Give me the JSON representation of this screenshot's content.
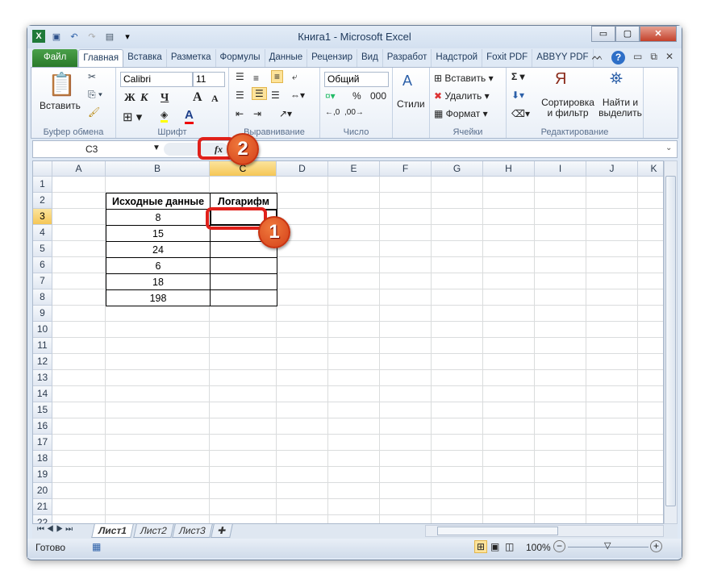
{
  "window": {
    "title": "Книга1  -  Microsoft Excel",
    "minimize": "▭",
    "restore": "▢",
    "close": "✕"
  },
  "tabs": [
    "Файл",
    "Главная",
    "Вставка",
    "Разметка",
    "Формулы",
    "Данные",
    "Рецензир",
    "Вид",
    "Разработ",
    "Надстрой",
    "Foxit PDF",
    "ABBYY PDF"
  ],
  "ribbon": {
    "clipboard": {
      "paste": "Вставить",
      "label": "Буфер обмена"
    },
    "font": {
      "name": "Calibri",
      "size": "11",
      "bold": "Ж",
      "italic": "К",
      "underline": "Ч",
      "grow": "A",
      "shrink": "A",
      "color": "A",
      "label": "Шрифт"
    },
    "alignment": {
      "label": "Выравнивание"
    },
    "number": {
      "format": "Общий",
      "percent": "%",
      "thousands": "000",
      "label": "Число"
    },
    "styles": {
      "label": "Стили"
    },
    "cells": {
      "insert": "Вставить",
      "delete": "Удалить",
      "format": "Формат",
      "label": "Ячейки"
    },
    "editing": {
      "sum": "Σ",
      "sort": "Сортировка и фильтр",
      "find": "Найти и выделить",
      "label": "Редактирование"
    }
  },
  "formula_bar": {
    "name_box": "C3",
    "fx": "fx",
    "value": ""
  },
  "columns": [
    "A",
    "B",
    "C",
    "D",
    "E",
    "F",
    "G",
    "H",
    "I",
    "J",
    "K"
  ],
  "selected": {
    "column": "C",
    "row": 3
  },
  "rows": 22,
  "table": {
    "header_b": "Исходные данные",
    "header_c": "Логарифм",
    "values": [
      "8",
      "15",
      "24",
      "6",
      "18",
      "198"
    ]
  },
  "sheets": [
    "Лист1",
    "Лист2",
    "Лист3"
  ],
  "active_sheet": "Лист1",
  "status": {
    "ready": "Готово",
    "zoom": "100%"
  },
  "annotations": [
    "1",
    "2"
  ],
  "colors": {
    "accent_red": "#e0201a",
    "badge": "#e05a28",
    "excel_green": "#2a7a2a"
  }
}
